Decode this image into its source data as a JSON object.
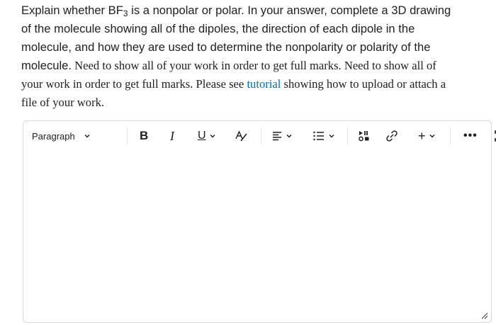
{
  "question": {
    "line1_pre": "Explain whether BF",
    "line1_sub": "3",
    "line1_post": " is a nonpolar or polar.  In your answer, complete a 3D drawing",
    "line2": "of the molecule showing all of the dipoles, the direction of each dipole in the",
    "line3": "molecule, and how they are used to determine the nonpolarity or polarity of the",
    "line4_sans": "molecule.",
    "line4_serif": "  Need to show all of your work in order to get full marks. Need to show all of",
    "line5_pre": "your work in order to get full marks. Please see ",
    "link": "tutorial",
    "line5_post": " showing how to upload or attach a",
    "line6": "file of your work."
  },
  "toolbar": {
    "paragraph_label": "Paragraph",
    "bold_label": "B",
    "italic_label": "I",
    "underline_label": "U",
    "insert_label": "+",
    "more_label": "•••"
  },
  "editor": {
    "value": ""
  },
  "icons": [
    "chevron-down-icon",
    "format-text-icon",
    "align-icon",
    "list-icon",
    "media-icon",
    "link-icon",
    "fullscreen-icon",
    "resize-handle-icon"
  ],
  "colors": {
    "link": "#006fbf",
    "border": "#d3d9e3",
    "text": "#202122"
  }
}
